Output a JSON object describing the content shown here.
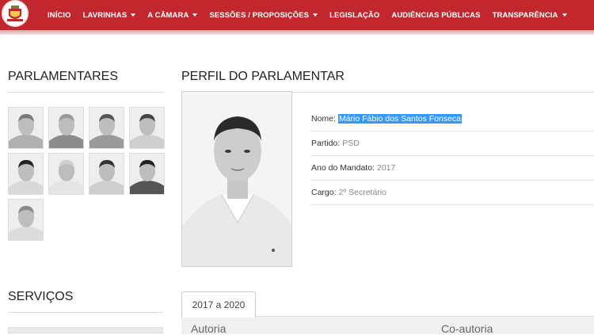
{
  "nav": {
    "items": [
      {
        "label": "INÍCIO",
        "dropdown": false
      },
      {
        "label": "LAVRINHAS",
        "dropdown": true
      },
      {
        "label": "A CÂMARA",
        "dropdown": true
      },
      {
        "label": "SESSÕES / PROPOSIÇÕES",
        "dropdown": true
      },
      {
        "label": "LEGISLAÇÃO",
        "dropdown": false
      },
      {
        "label": "AUDIÊNCIAS PÚBLICAS",
        "dropdown": false
      },
      {
        "label": "TRANSPARÊNCIA",
        "dropdown": true
      }
    ],
    "color": "#c1272d"
  },
  "sidebar": {
    "parlamentares_title": "PARLAMENTARES",
    "parlamentares_count": 9,
    "servicos_title": "SERVIÇOS"
  },
  "profile": {
    "title": "PERFIL DO PARLAMENTAR",
    "nome_label": "Nome:",
    "nome_value": "Mário Fábio dos Santos Fonseca",
    "partido_label": "Partido:",
    "partido_value": "PSD",
    "ano_label": "Ano do Mandato:",
    "ano_value": "2017",
    "cargo_label": "Cargo:",
    "cargo_value": "2º Secretário",
    "selection_color": "#3399ff"
  },
  "tabs": {
    "active": "2017 a 2020",
    "col_autoria": "Autoria",
    "col_coautoria": "Co-autoria"
  }
}
